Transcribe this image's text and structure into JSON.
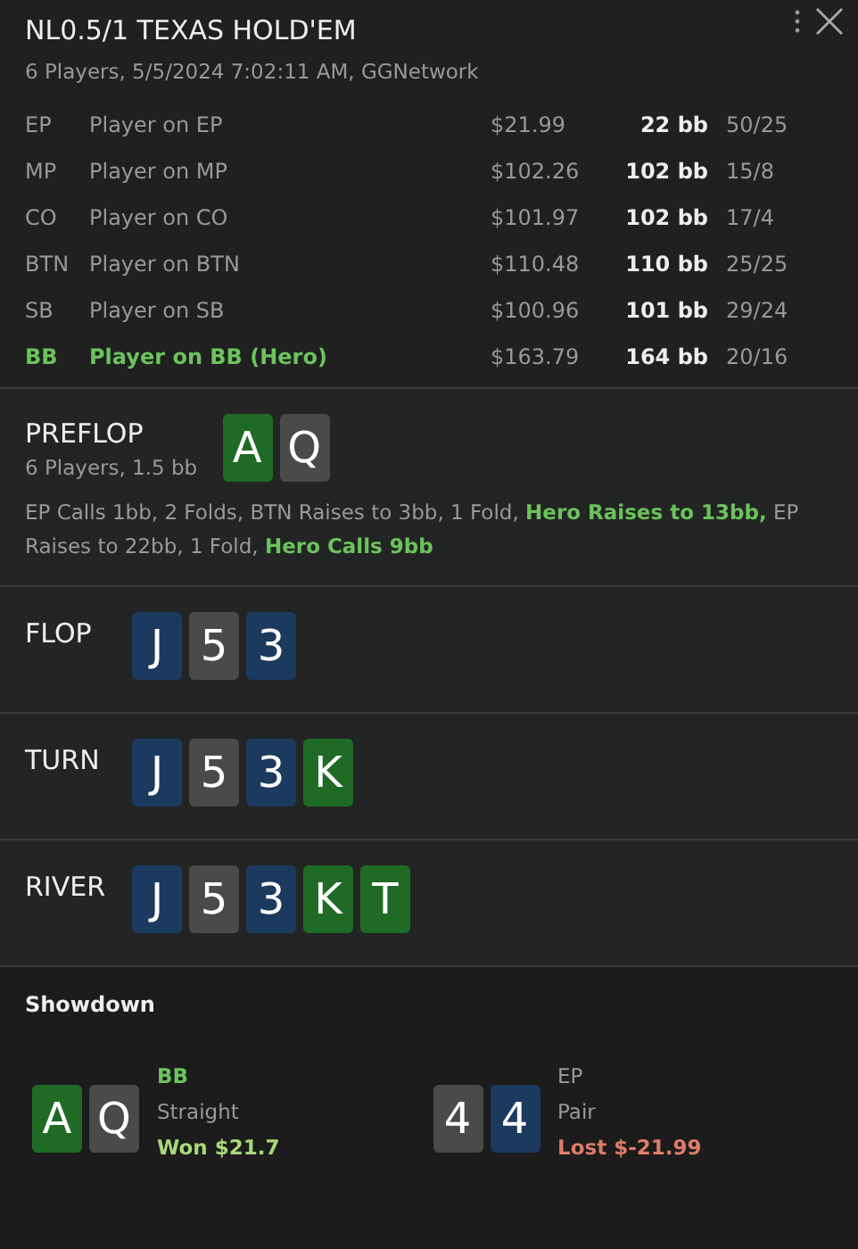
{
  "header": {
    "title": "NL0.5/1 TEXAS HOLD'EM",
    "subtitle": "6 Players, 5/5/2024 7:02:11 AM, GGNetwork"
  },
  "players": [
    {
      "position": "EP",
      "name": "Player on EP",
      "stack": "$21.99",
      "bb": "22 bb",
      "stats": "50/25",
      "hero": false
    },
    {
      "position": "MP",
      "name": "Player on MP",
      "stack": "$102.26",
      "bb": "102 bb",
      "stats": "15/8",
      "hero": false
    },
    {
      "position": "CO",
      "name": "Player on CO",
      "stack": "$101.97",
      "bb": "102 bb",
      "stats": "17/4",
      "hero": false
    },
    {
      "position": "BTN",
      "name": "Player on BTN",
      "stack": "$110.48",
      "bb": "110 bb",
      "stats": "25/25",
      "hero": false
    },
    {
      "position": "SB",
      "name": "Player on SB",
      "stack": "$100.96",
      "bb": "101 bb",
      "stats": "29/24",
      "hero": false
    },
    {
      "position": "BB",
      "name": "Player on BB (Hero)",
      "stack": "$163.79",
      "bb": "164 bb",
      "stats": "20/16",
      "hero": true
    }
  ],
  "streets": [
    {
      "name": "PREFLOP",
      "info": "6 Players, 1.5 bb",
      "cards": [
        {
          "rank": "A",
          "color": "#1f6b25"
        },
        {
          "rank": "Q",
          "color": "#4a4a4a"
        }
      ],
      "actions": "EP Calls 1bb, 2 Folds, BTN Raises to 3bb, 1 Fold, **Hero Raises to 13bb,** EP Raises to 22bb, 1 Fold, **Hero Calls 9bb**"
    },
    {
      "name": "FLOP",
      "cards": [
        {
          "rank": "J",
          "color": "#1b3a5e"
        },
        {
          "rank": "5",
          "color": "#4a4a4a"
        },
        {
          "rank": "3",
          "color": "#1b3a5e"
        }
      ]
    },
    {
      "name": "TURN",
      "cards": [
        {
          "rank": "J",
          "color": "#1b3a5e"
        },
        {
          "rank": "5",
          "color": "#4a4a4a"
        },
        {
          "rank": "3",
          "color": "#1b3a5e"
        },
        {
          "rank": "K",
          "color": "#1f6b25"
        }
      ]
    },
    {
      "name": "RIVER",
      "cards": [
        {
          "rank": "J",
          "color": "#1b3a5e"
        },
        {
          "rank": "5",
          "color": "#4a4a4a"
        },
        {
          "rank": "3",
          "color": "#1b3a5e"
        },
        {
          "rank": "K",
          "color": "#1f6b25"
        },
        {
          "rank": "T",
          "color": "#1f6b25"
        }
      ]
    }
  ],
  "showdown": {
    "title": "Showdown",
    "hands": [
      {
        "cards": [
          {
            "rank": "A",
            "color": "#1f6b25"
          },
          {
            "rank": "Q",
            "color": "#4a4a4a"
          }
        ],
        "position": "BB",
        "hero": true,
        "hand": "Straight",
        "result": "Won $21.7",
        "kind": "won"
      },
      {
        "cards": [
          {
            "rank": "4",
            "color": "#4a4a4a"
          },
          {
            "rank": "4",
            "color": "#1b3a5e"
          }
        ],
        "position": "EP",
        "hero": false,
        "hand": "Pair",
        "result": "Lost $-21.99",
        "kind": "lost"
      }
    ]
  }
}
